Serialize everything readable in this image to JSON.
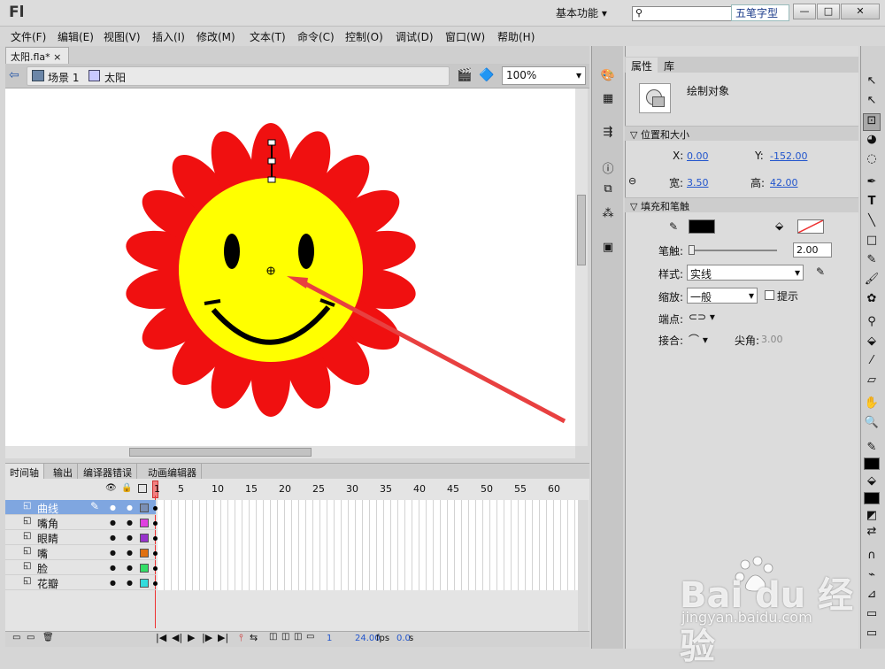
{
  "app": {
    "logo": "Fl",
    "workspace": "基本功能",
    "ime_badge": "五笔字型",
    "window_buttons": [
      "—",
      "□",
      "✕"
    ]
  },
  "menus": [
    "文件(F)",
    "编辑(E)",
    "视图(V)",
    "插入(I)",
    "修改(M)",
    "文本(T)",
    "命令(C)",
    "控制(O)",
    "调试(D)",
    "窗口(W)",
    "帮助(H)"
  ],
  "document": {
    "tab": "太阳.fla*",
    "close": "×",
    "scene": "场景 1",
    "symbol": "太阳",
    "zoom": "100%"
  },
  "timeline": {
    "tabs": [
      "时间轴",
      "输出",
      "编译器错误",
      "动画编辑器"
    ],
    "ruler": [
      "1",
      "5",
      "10",
      "15",
      "20",
      "25",
      "30",
      "35",
      "40",
      "45",
      "50",
      "55",
      "60"
    ],
    "layers": [
      {
        "name": "曲线",
        "color": "#7a8fb5",
        "selected": true
      },
      {
        "name": "嘴角",
        "color": "#e040e0",
        "selected": false
      },
      {
        "name": "眼睛",
        "color": "#9933cc",
        "selected": false
      },
      {
        "name": "嘴",
        "color": "#e07010",
        "selected": false
      },
      {
        "name": "脸",
        "color": "#33dd66",
        "selected": false
      },
      {
        "name": "花瓣",
        "color": "#33dddd",
        "selected": false
      }
    ],
    "footer": {
      "frame": "1",
      "fps": "24.00",
      "fps_unit": "fps",
      "time": "0.0",
      "time_unit": "s"
    }
  },
  "properties": {
    "tabs": [
      "属性",
      "库"
    ],
    "object_type": "绘制对象",
    "sec_position": "位置和大小",
    "x_label": "X:",
    "x": "0.00",
    "y_label": "Y:",
    "y": "-152.00",
    "w_label": "宽:",
    "w": "3.50",
    "h_label": "高:",
    "h": "42.00",
    "sec_fill": "填充和笔触",
    "stroke_label": "笔触:",
    "stroke": "2.00",
    "style_label": "样式:",
    "style": "实线",
    "scale_label": "缩放:",
    "scale": "一般",
    "hint_label": "提示",
    "cap_label": "端点:",
    "join_label": "接合:",
    "miter_label": "尖角:",
    "miter": "3.00"
  },
  "watermark": {
    "brand": "Bai du 经验",
    "url": "jingyan.baidu.com"
  },
  "colors": {
    "petal": "#f01010",
    "face": "#ffff00",
    "feature": "#000000",
    "arrow": "#e84040"
  }
}
